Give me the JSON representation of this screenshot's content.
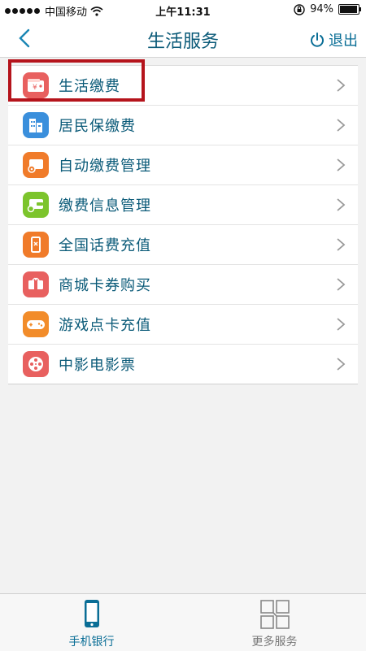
{
  "status": {
    "carrier": "中国移动",
    "time": "上午11:31",
    "battery": "94%",
    "battery_level": 0.94
  },
  "nav": {
    "title": "生活服务",
    "logout_label": "退出"
  },
  "menu": {
    "items": [
      {
        "label": "生活缴费",
        "icon": "wallet-yen-icon",
        "color": "#e8605f"
      },
      {
        "label": "居民保缴费",
        "icon": "buildings-icon",
        "color": "#3a8fdc"
      },
      {
        "label": "自动缴费管理",
        "icon": "auto-wallet-icon",
        "color": "#f07b2a"
      },
      {
        "label": "缴费信息管理",
        "icon": "wallet-settings-icon",
        "color": "#7cc42c"
      },
      {
        "label": "全国话费充值",
        "icon": "phone-recharge-icon",
        "color": "#f07b2a"
      },
      {
        "label": "商城卡券购买",
        "icon": "gift-card-icon",
        "color": "#e8605f"
      },
      {
        "label": "游戏点卡充值",
        "icon": "gamepad-icon",
        "color": "#f28c2a"
      },
      {
        "label": "中影电影票",
        "icon": "film-reel-icon",
        "color": "#e8605f"
      }
    ]
  },
  "tabs": {
    "mobile_bank": "手机银行",
    "more_services": "更多服务"
  },
  "colors": {
    "accent": "#0a6e96",
    "highlight": "#b5141c"
  }
}
